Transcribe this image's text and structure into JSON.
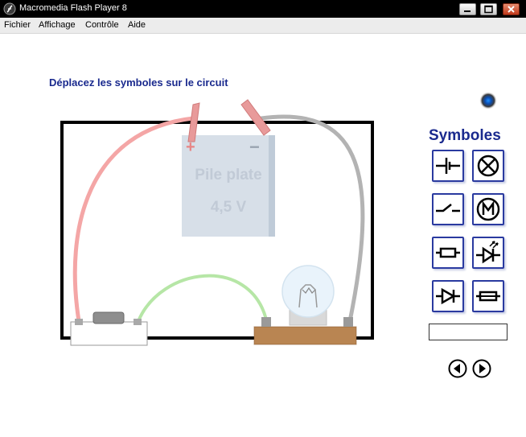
{
  "window": {
    "title": "Macromedia Flash Player 8"
  },
  "menu": {
    "items": [
      "Fichier",
      "Affichage",
      "Contrôle",
      "Aide"
    ]
  },
  "instruction": "Déplacez les symboles sur le circuit",
  "battery": {
    "label_line1": "Pile plate",
    "label_line2": "4,5 V",
    "plus": "+",
    "minus": "−"
  },
  "symbols_panel": {
    "title": "Symboles",
    "items": [
      {
        "icon": "cell-symbol-icon"
      },
      {
        "icon": "lamp-symbol-icon"
      },
      {
        "icon": "switch-symbol-icon"
      },
      {
        "icon": "motor-symbol-icon"
      },
      {
        "icon": "resistor-symbol-icon"
      },
      {
        "icon": "led-symbol-icon"
      },
      {
        "icon": "diode-symbol-icon"
      },
      {
        "icon": "fuse-symbol-icon"
      }
    ]
  },
  "answer_field": {
    "value": ""
  },
  "colors": {
    "accent": "#1a2a8e",
    "wire_red": "#f4a6a6",
    "wire_green": "#b6e6a6",
    "wire_grey": "#b3b3b3",
    "frame": "#000000"
  }
}
